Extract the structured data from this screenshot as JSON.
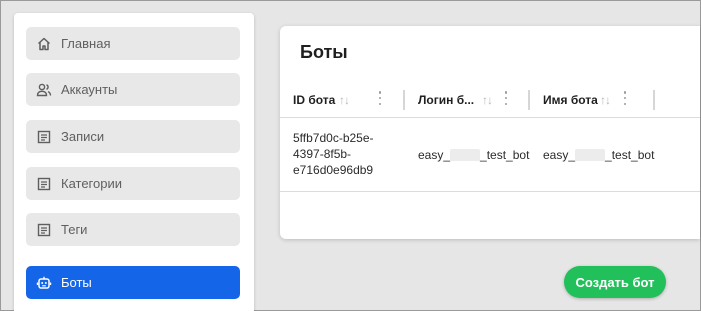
{
  "sidebar": {
    "items": [
      {
        "label": "Главная",
        "icon": "home-icon"
      },
      {
        "label": "Аккаунты",
        "icon": "users-icon"
      },
      {
        "label": "Записи",
        "icon": "document-icon"
      },
      {
        "label": "Категории",
        "icon": "document-icon"
      },
      {
        "label": "Теги",
        "icon": "document-icon"
      },
      {
        "label": "Боты",
        "icon": "robot-icon",
        "active": true
      }
    ]
  },
  "main": {
    "title": "Боты",
    "table": {
      "columns": [
        "ID бота",
        "Логин б...",
        "Имя бота"
      ],
      "rows": [
        {
          "id_lines": [
            "5ffb7d0c-b25e-",
            "4397-8f5b-",
            "e716d0e96db9"
          ],
          "login_prefix": "easy_",
          "login_suffix": "_test_bot",
          "name_prefix": "easy_",
          "name_suffix": "_test_bot"
        }
      ]
    }
  },
  "actions": {
    "create_label": "Создать бот"
  },
  "colors": {
    "active": "#1565e8",
    "primary_action": "#22c05a",
    "nav_bg": "#e8e8e8"
  }
}
